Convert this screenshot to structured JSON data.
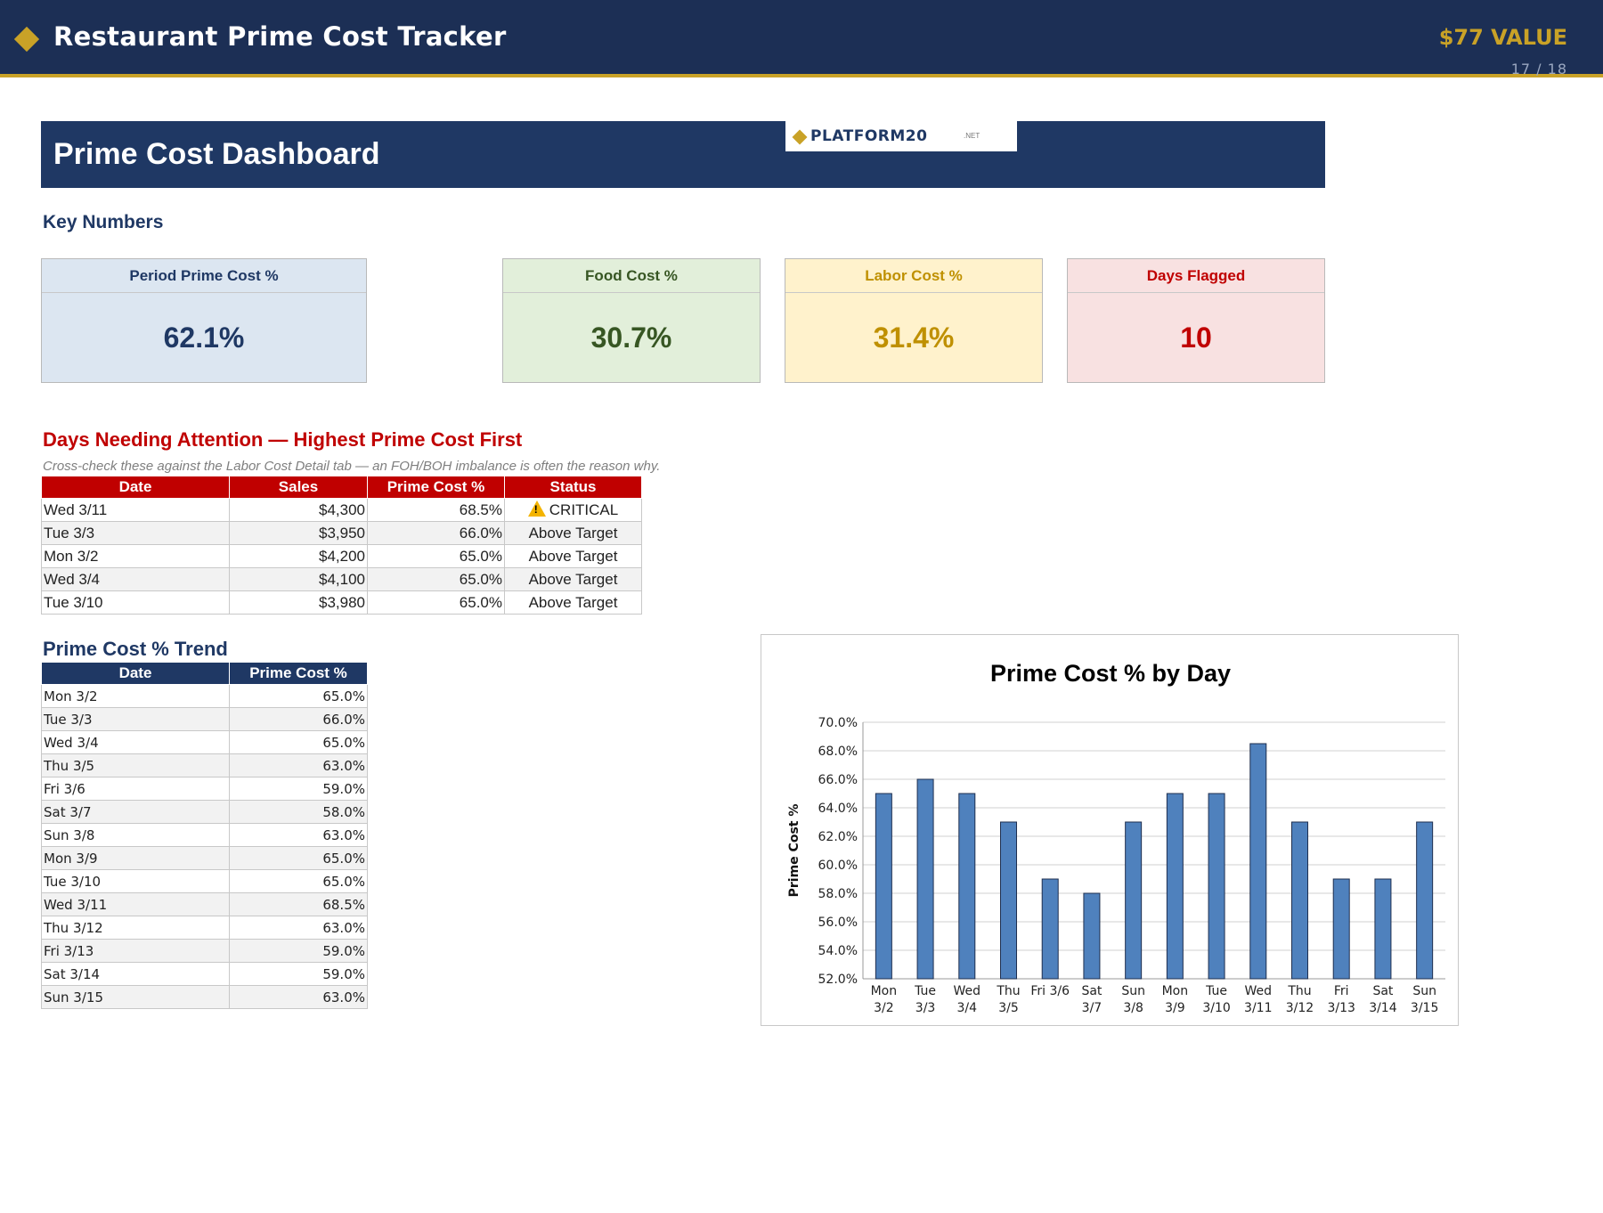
{
  "header": {
    "title": "Restaurant Prime Cost Tracker",
    "value_badge": "$77 VALUE",
    "page_indicator": "17 / 18"
  },
  "banner": {
    "title": "Prime Cost Dashboard",
    "logo_text": "PLATFORM20",
    "logo_suffix": ".NET"
  },
  "key_numbers": {
    "heading": "Key Numbers",
    "cards": [
      {
        "label": "Period Prime Cost %",
        "value": "62.1%"
      },
      {
        "label": "Food Cost %",
        "value": "30.7%"
      },
      {
        "label": "Labor Cost %",
        "value": "31.4%"
      },
      {
        "label": "Days Flagged",
        "value": "10"
      }
    ]
  },
  "attention": {
    "title": "Days Needing Attention — Highest Prime Cost First",
    "note": "Cross-check these against the Labor Cost Detail tab — an FOH/BOH imbalance is often the reason why.",
    "columns": [
      "Date",
      "Sales",
      "Prime Cost %",
      "Status"
    ],
    "rows": [
      {
        "date": "Wed 3/11",
        "sales": "$4,300",
        "pct": "68.5%",
        "status": "CRITICAL"
      },
      {
        "date": "Tue 3/3",
        "sales": "$3,950",
        "pct": "66.0%",
        "status": "Above Target"
      },
      {
        "date": "Mon 3/2",
        "sales": "$4,200",
        "pct": "65.0%",
        "status": "Above Target"
      },
      {
        "date": "Wed 3/4",
        "sales": "$4,100",
        "pct": "65.0%",
        "status": "Above Target"
      },
      {
        "date": "Tue 3/10",
        "sales": "$3,980",
        "pct": "65.0%",
        "status": "Above Target"
      }
    ]
  },
  "trend": {
    "title": "Prime Cost % Trend",
    "columns": [
      "Date",
      "Prime Cost %"
    ],
    "rows": [
      {
        "date": "Mon 3/2",
        "pct": "65.0%"
      },
      {
        "date": "Tue 3/3",
        "pct": "66.0%"
      },
      {
        "date": "Wed 3/4",
        "pct": "65.0%"
      },
      {
        "date": "Thu 3/5",
        "pct": "63.0%"
      },
      {
        "date": "Fri 3/6",
        "pct": "59.0%"
      },
      {
        "date": "Sat 3/7",
        "pct": "58.0%"
      },
      {
        "date": "Sun 3/8",
        "pct": "63.0%"
      },
      {
        "date": "Mon 3/9",
        "pct": "65.0%"
      },
      {
        "date": "Tue 3/10",
        "pct": "65.0%"
      },
      {
        "date": "Wed 3/11",
        "pct": "68.5%"
      },
      {
        "date": "Thu 3/12",
        "pct": "63.0%"
      },
      {
        "date": "Fri 3/13",
        "pct": "59.0%"
      },
      {
        "date": "Sat 3/14",
        "pct": "59.0%"
      },
      {
        "date": "Sun 3/15",
        "pct": "63.0%"
      }
    ]
  },
  "chart_data": {
    "type": "bar",
    "title": "Prime Cost % by Day",
    "xlabel": "",
    "ylabel": "Prime Cost %",
    "categories": [
      [
        "Mon",
        "3/2"
      ],
      [
        "Tue",
        "3/3"
      ],
      [
        "Wed",
        "3/4"
      ],
      [
        "Thu",
        "3/5"
      ],
      [
        "Fri 3/6",
        ""
      ],
      [
        "Sat",
        "3/7"
      ],
      [
        "Sun",
        "3/8"
      ],
      [
        "Mon",
        "3/9"
      ],
      [
        "Tue",
        "3/10"
      ],
      [
        "Wed",
        "3/11"
      ],
      [
        "Thu",
        "3/12"
      ],
      [
        "Fri",
        "3/13"
      ],
      [
        "Sat",
        "3/14"
      ],
      [
        "Sun",
        "3/15"
      ]
    ],
    "values": [
      65.0,
      66.0,
      65.0,
      63.0,
      59.0,
      58.0,
      63.0,
      65.0,
      65.0,
      68.5,
      63.0,
      59.0,
      59.0,
      63.0
    ],
    "ylim": [
      52,
      70
    ],
    "yticks": [
      "52.0%",
      "54.0%",
      "56.0%",
      "58.0%",
      "60.0%",
      "62.0%",
      "64.0%",
      "66.0%",
      "68.0%",
      "70.0%"
    ],
    "grid": true,
    "bar_color": "#4f81bd"
  }
}
